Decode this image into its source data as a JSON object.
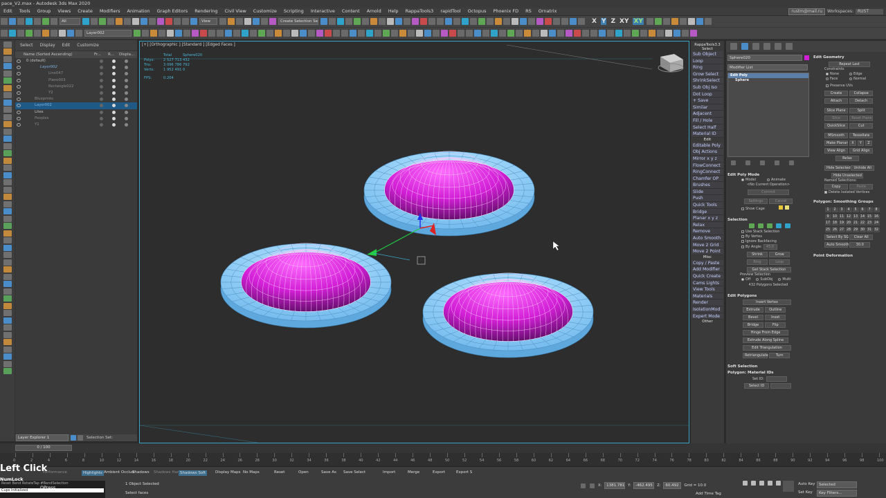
{
  "title": "pace_V2.max - Autodesk 3ds Max 2020",
  "menu": [
    "Edit",
    "Tools",
    "Group",
    "Views",
    "Create",
    "Modifiers",
    "Animation",
    "Graph Editors",
    "Rendering",
    "Civil View",
    "Customize",
    "Scripting",
    "Interactive",
    "Content",
    "Arnold",
    "Help",
    "RappaTools3",
    "rapidTool",
    "Octopus",
    "Phoenix FD",
    "RS",
    "Ornatrix"
  ],
  "user": "rustm@mail.ru",
  "workspaces_label": "Workspaces:",
  "workspace": "RUST",
  "toolbar": {
    "filter": "All",
    "view": "View",
    "selection_set": "Create Selection Se",
    "layer": "Layer002",
    "axes": [
      "X",
      "Y",
      "Z",
      "XY",
      "XY"
    ]
  },
  "explorer": {
    "tabs": [
      "Select",
      "Display",
      "Edit",
      "Customize"
    ],
    "header": "Name (Sorted Ascending)",
    "col_fr": "Fr...",
    "col_r": "R...",
    "col_disp": "Displa...",
    "rows": [
      {
        "name": "0 (default)",
        "indent": 16,
        "style": ""
      },
      {
        "name": "Layer002",
        "indent": 36,
        "style": "hlt italic"
      },
      {
        "name": "Line047",
        "indent": 48,
        "style": "faded"
      },
      {
        "name": "Plane003",
        "indent": 48,
        "style": "faded"
      },
      {
        "name": "Rectangle022",
        "indent": 48,
        "style": "faded"
      },
      {
        "name": "Y2",
        "indent": 48,
        "style": "faded"
      },
      {
        "name": "Blueprints",
        "indent": 28,
        "style": "faded"
      },
      {
        "name": "Layer002",
        "indent": 28,
        "style": "hlt",
        "sel": true
      },
      {
        "name": "Lites",
        "indent": 28,
        "style": ""
      },
      {
        "name": "Peoples",
        "indent": 28,
        "style": "faded"
      },
      {
        "name": "Y1",
        "indent": 28,
        "style": "faded"
      }
    ],
    "layer_explorer": "Layer Explorer 1",
    "selection_set_label": "Selection Set:"
  },
  "viewport": {
    "label": "[+] [Orthographic ] [Standard ] [Edged Faces ]",
    "stats_header": [
      "",
      "Total",
      "Sphere020"
    ],
    "stats": [
      {
        "k": "Polys:",
        "total": "2 527 713",
        "sel": "432"
      },
      {
        "k": "Tris:",
        "total": "3 096 786",
        "sel": "792"
      },
      {
        "k": "Verts:",
        "total": "1 952 491",
        "sel": "0"
      }
    ],
    "fps_label": "FPS:",
    "fps": "0.204"
  },
  "rappa": {
    "title": "RappaTools3.3",
    "select_label": "Select",
    "select_items": [
      "Sub Object",
      "Loop",
      "Ring",
      "Grow Select",
      "ShrinkSelect",
      "Sub Obj Iso",
      "Dot Loop",
      "+ Save",
      "Similar",
      "Adjacent",
      "Fill / Hole",
      "Select Half",
      "Material ID"
    ],
    "edit_label": "Edit",
    "edit_items": [
      "Editable Poly",
      "Obj Actions",
      "Mirror  x y z",
      "FlowConnect",
      "RingConnect",
      "Chamfer OP",
      "Brushes",
      "Slide",
      "Push",
      "Quick Tools",
      "Bridge",
      "Planar x y z",
      "Relax",
      "Remove",
      "Auto Smooth",
      "Move 2 Grid",
      "Move 2 Point"
    ],
    "misc_label": "Misc",
    "misc_items": [
      "Copy / Paste",
      "Add Modifier",
      "Quick Create",
      "Cams Lights",
      "View Tools",
      "Materials",
      "Render",
      "IsolationMod",
      "Expert Mode"
    ],
    "other_label": "Other"
  },
  "command": {
    "object_name": "Sphere020",
    "modifier_list": "Modifier List",
    "stack": [
      "Edit Poly",
      "Sphere"
    ],
    "edit_geometry": "Edit Geometry",
    "repeat_last": "Repeat Last",
    "constraints": "Constraints",
    "c_none": "None",
    "c_edge": "Edge",
    "c_face": "Face",
    "c_normal": "Normal",
    "preserve_uvs": "Preserve UVs",
    "create": "Create",
    "collapse": "Collapse",
    "attach": "Attach",
    "detach": "Detach",
    "slice_plane": "Slice Plane",
    "split": "Split",
    "slice": "Slice",
    "reset_plane": "Reset Plane",
    "quickslice": "QuickSlice",
    "cut": "Cut",
    "msmooth": "MSmooth",
    "tessellate": "Tessellate",
    "make_planar": "Make Planar",
    "x": "X",
    "y": "Y",
    "z": "Z",
    "view_align": "View Align",
    "grid_align": "Grid Align",
    "relax": "Relax",
    "hide_selected": "Hide Selected",
    "unhide_all": "Unhide All",
    "hide_unselected": "Hide Unselected",
    "named_selections": "Named Selections:",
    "copy": "Copy",
    "paste": "Paste",
    "delete_isolated": "Delete Isolated Vertices",
    "smoothing_groups": "Polygon: Smoothing Groups",
    "sg_numbers": [
      "1",
      "2",
      "3",
      "4",
      "5",
      "6",
      "7",
      "8",
      "9",
      "10",
      "11",
      "12",
      "13",
      "14",
      "15",
      "16",
      "17",
      "18",
      "19",
      "20",
      "21",
      "22",
      "23",
      "24",
      "25",
      "26",
      "27",
      "28",
      "29",
      "30",
      "31",
      "32"
    ],
    "select_by_sg": "Select By SG",
    "clear_all": "Clear All",
    "auto_smooth": "Auto Smooth",
    "auto_smooth_val": "30.0",
    "point_deformation": "Point Deformation",
    "edit_poly_mode": "Edit Poly Mode",
    "model": "Model",
    "animate": "Animate",
    "no_op": "<No Current Operation>",
    "commit": "Commit",
    "settings": "Settings",
    "cancel": "Cancel",
    "show_cage": "Show Cage",
    "selection": "Selection",
    "use_stack": "Use Stack Selection",
    "by_vertex": "By Vertex",
    "ignore_backfacing": "Ignore Backfacing",
    "by_angle": "By Angle:",
    "by_angle_val": "45.0",
    "shrink": "Shrink",
    "grow": "Grow",
    "ring": "Ring",
    "loop": "Loop",
    "get_stack": "Get Stack Selection",
    "preview_selection": "Preview Selection",
    "off": "Off",
    "subobj": "SubObj",
    "multi": "Multi",
    "polys_selected": "432 Polygons Selected",
    "edit_polygons": "Edit Polygons",
    "insert_vertex": "Insert Vertex",
    "extrude": "Extrude",
    "outline": "Outline",
    "bevel": "Bevel",
    "inset": "Inset",
    "bridge": "Bridge",
    "flip": "Flip",
    "hinge": "Hinge From Edge",
    "extrude_spline": "Extrude Along Spline",
    "edit_triangulation": "Edit Triangulation",
    "retriangulate": "Retriangulate",
    "turn": "Turn",
    "soft_selection": "Soft Selection",
    "material_ids": "Polygon: Material IDs",
    "set_id": "Set ID:",
    "select_id": "Select ID"
  },
  "timeline": {
    "frame": "0 / 100",
    "ticks": [
      "0",
      "2",
      "4",
      "6",
      "8",
      "10",
      "12",
      "14",
      "16",
      "18",
      "20",
      "22",
      "24",
      "26",
      "28",
      "30",
      "32",
      "34",
      "36",
      "38",
      "40",
      "42",
      "44",
      "46",
      "48",
      "50",
      "52",
      "54",
      "56",
      "58",
      "60",
      "62",
      "64",
      "66",
      "68",
      "70",
      "72",
      "74",
      "76",
      "78",
      "80",
      "82",
      "84",
      "86",
      "88",
      "90",
      "92",
      "94",
      "96",
      "98",
      "100"
    ]
  },
  "bottom": {
    "buttons": [
      "Performance",
      "Highlights",
      "Ambient Occlusi",
      "Shadows",
      "Shadows Hard",
      "Shadows Soft",
      "Display Maps",
      "No Maps",
      "Reset",
      "Open",
      "Save As",
      "Save Select",
      "Import",
      "Merge",
      "Export",
      "Export S"
    ],
    "status1": "1 Object Selected",
    "status2": "Select faces",
    "x": "1381.781",
    "y": "-462.495",
    "z": "60.492",
    "grid": "Grid = 10.0",
    "add_time_tag": "Add Time Tag",
    "auto_key": "Auto Key",
    "set_key": "Set Key",
    "selected": "Selected",
    "key_filters": "Key Filters...",
    "script1": "Reset Bend RotateTap #BendSelection",
    "script2": "Cups Initialized"
  },
  "overlay": {
    "left_click": "Left Click",
    "numlock": "NumLock",
    "qpress": "QPress"
  },
  "colors": {
    "accent": "#3aa6c7",
    "dome": "#d21fd6",
    "rim": "#8fd0f8",
    "rappa_text": "#c6d2ff"
  }
}
